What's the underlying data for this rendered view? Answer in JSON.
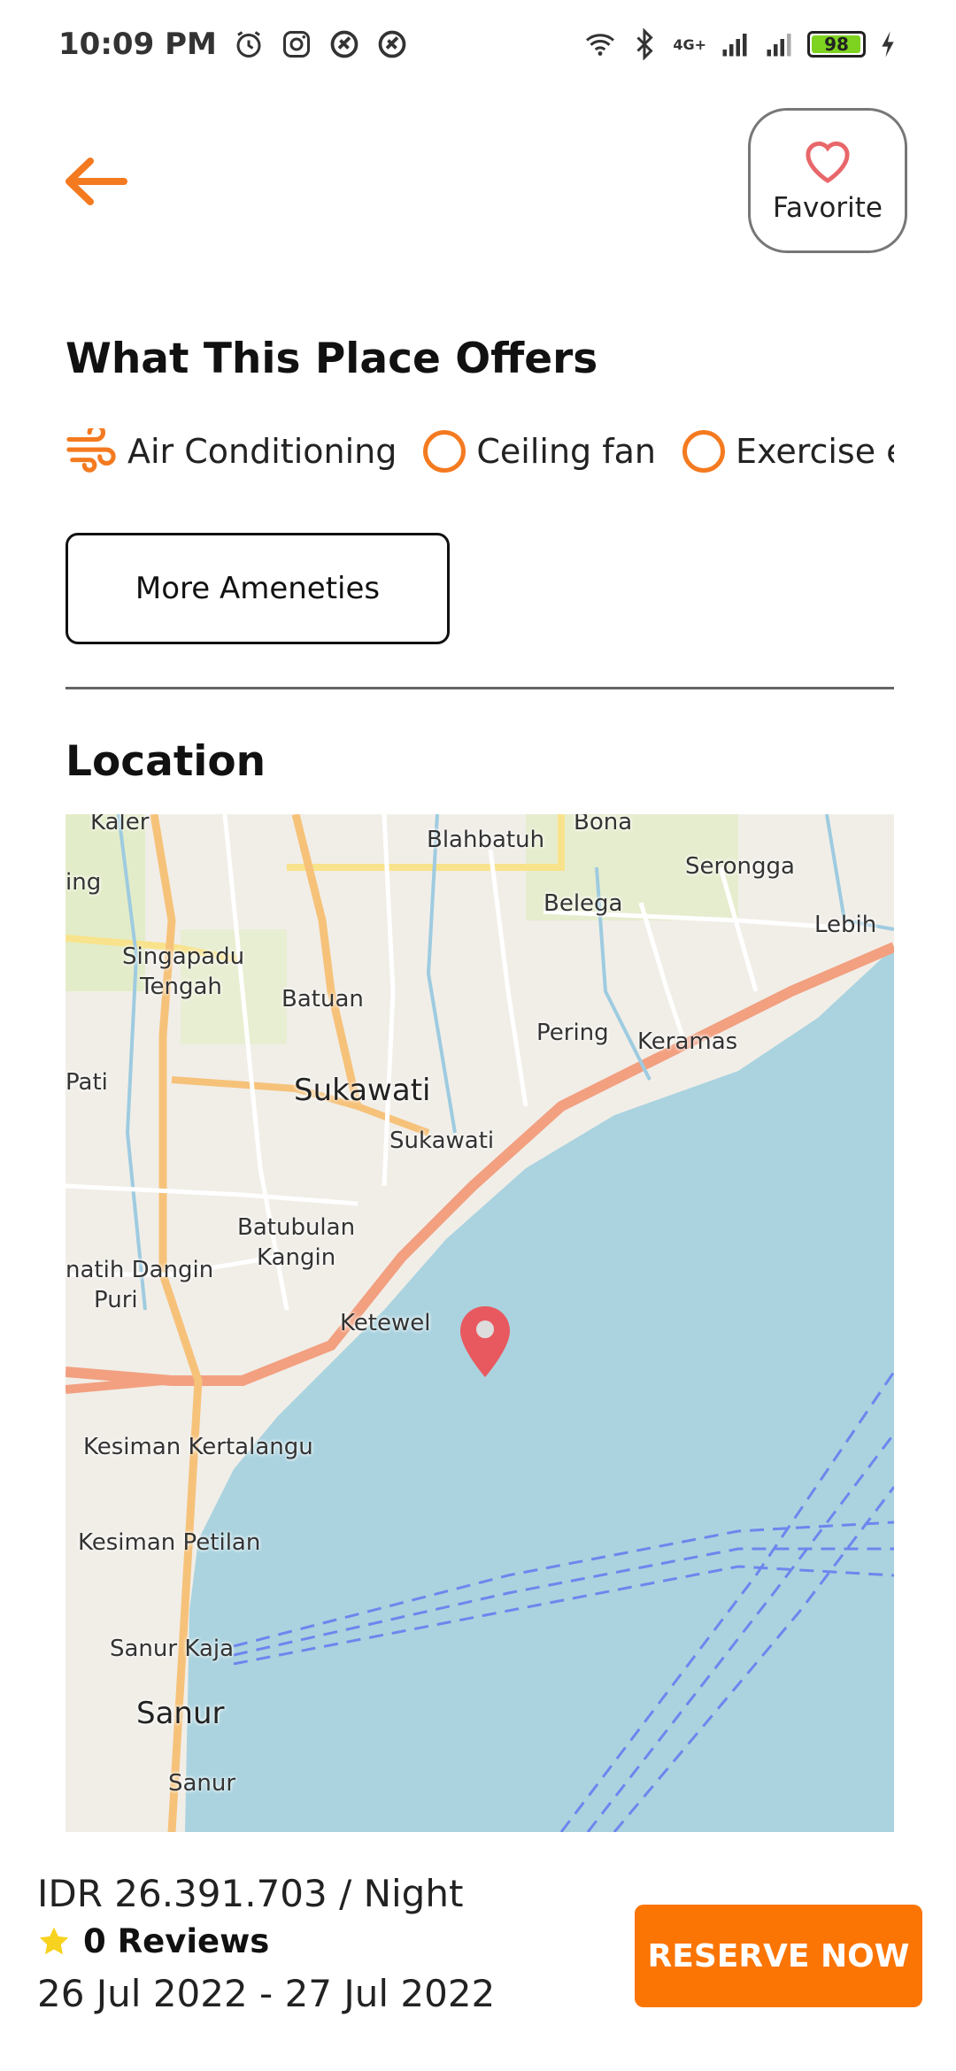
{
  "status_bar": {
    "time": "10:09 PM",
    "battery": "98",
    "network": "4G+"
  },
  "header": {
    "favorite_label": "Favorite",
    "accent_color": "#f47a20"
  },
  "amenities_section": {
    "title": "What This Place Offers",
    "items": [
      {
        "label": "Air Conditioning",
        "icon": "wind-icon"
      },
      {
        "label": "Ceiling fan",
        "icon": "circle-icon"
      },
      {
        "label": "Exercise equipment",
        "icon": "circle-icon"
      }
    ],
    "more_button": "More Ameneties"
  },
  "location_section": {
    "title": "Location",
    "map_labels": [
      "Kaler",
      "Bona",
      "Blahbatuh",
      "ing",
      "Serongga",
      "Belega",
      "Lebih",
      "Singapadu",
      "Tengah",
      "Batuan",
      "Pering",
      "Keramas",
      "Pati",
      "Sukawati",
      "Sukawati",
      "Batubulan",
      "Kangin",
      "natih Dangin",
      "Puri",
      "Ketewel",
      "Kesiman Kertalangu",
      "Kesiman Petilan",
      "Sanur Kaja",
      "Sanur",
      "Sanur"
    ]
  },
  "booking_bar": {
    "price": "IDR 26.391.703 / Night",
    "reviews": "0 Reviews",
    "dates": "26 Jul 2022 - 27 Jul 2022",
    "reserve_button": "RESERVE NOW",
    "button_color": "#fb7504"
  }
}
